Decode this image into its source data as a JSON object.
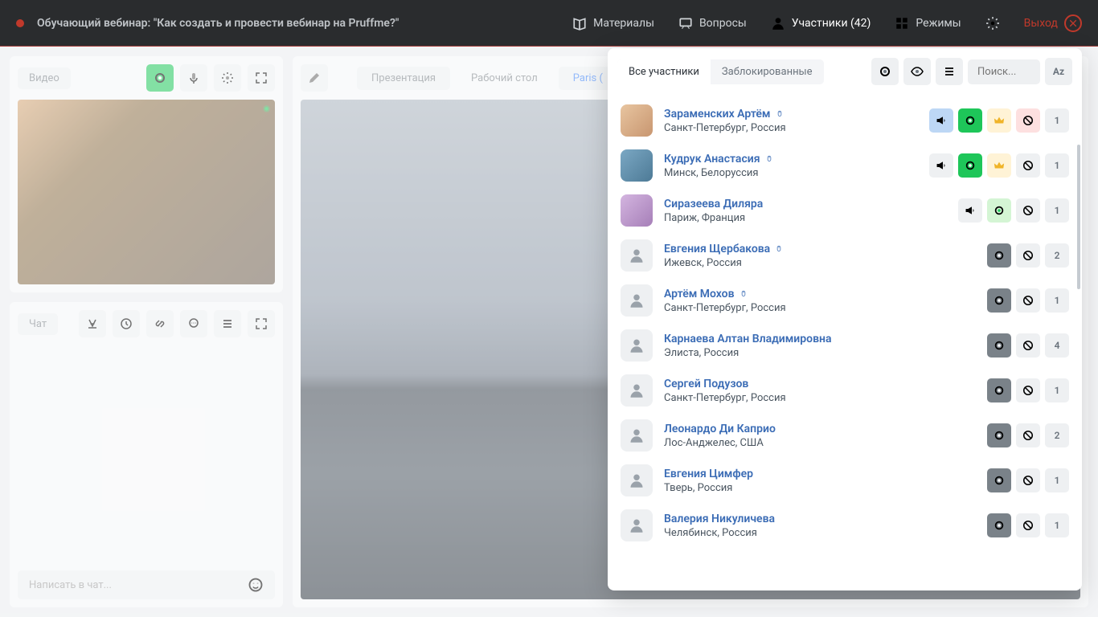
{
  "topbar": {
    "title": "Обучающий вебинар: \"Как создать и провести вебинар на Pruffme?\"",
    "menu": {
      "materials": "Материалы",
      "questions": "Вопросы",
      "participants": "Участники (42)",
      "modes": "Режимы"
    },
    "exit": "Выход"
  },
  "video": {
    "label": "Видео"
  },
  "chat": {
    "label": "Чат",
    "placeholder": "Написать в чат..."
  },
  "main": {
    "tabs": {
      "presentation": "Презентация",
      "desktop": "Рабочий стол",
      "file": "Paris ("
    }
  },
  "participants": {
    "tabs": {
      "all": "Все участники",
      "blocked": "Заблокированные"
    },
    "search_placeholder": "Поиск...",
    "sort": "Az",
    "list": [
      {
        "name": "Зараменских Артём",
        "location": "Санкт-Петербург, Россия",
        "count": "1",
        "mouse": true,
        "photo": "photo1",
        "actions": [
          "horn-blue",
          "cam-green",
          "crown-yellow",
          "ban-red"
        ]
      },
      {
        "name": "Кудрук Анастасия",
        "location": "Минск, Белоруссия",
        "count": "1",
        "mouse": true,
        "photo": "photo2",
        "actions": [
          "horn-gray",
          "cam-green",
          "crown-yellow",
          "ban-gray"
        ]
      },
      {
        "name": "Сиразеева Диляра",
        "location": "Париж, Франция",
        "count": "1",
        "mouse": false,
        "photo": "photo3",
        "actions": [
          "horn-gray-off",
          "cam-greenlt",
          "ban-gray"
        ]
      },
      {
        "name": "Евгения Щербакова",
        "location": "Ижевск, Россия",
        "count": "2",
        "mouse": true,
        "photo": "",
        "actions": [
          "cam-dark",
          "ban-gray"
        ]
      },
      {
        "name": "Артём Мохов",
        "location": "Санкт-Петербург, Россия",
        "count": "1",
        "mouse": true,
        "photo": "",
        "actions": [
          "cam-dark",
          "ban-gray"
        ]
      },
      {
        "name": "Карнаева Алтан Владимировна",
        "location": "Элиста, Россия",
        "count": "4",
        "mouse": false,
        "photo": "",
        "actions": [
          "cam-dark",
          "ban-gray"
        ]
      },
      {
        "name": "Сергей Подузов",
        "location": "Санкт-Петербург, Россия",
        "count": "1",
        "mouse": false,
        "photo": "",
        "actions": [
          "cam-dark",
          "ban-gray"
        ]
      },
      {
        "name": "Леонардо Ди Каприо",
        "location": "Лос-Анджелес, США",
        "count": "2",
        "mouse": false,
        "photo": "",
        "actions": [
          "cam-dark",
          "ban-gray"
        ]
      },
      {
        "name": "Евгения Цимфер",
        "location": "Тверь, Россия",
        "count": "1",
        "mouse": false,
        "photo": "",
        "actions": [
          "cam-dark",
          "ban-gray"
        ]
      },
      {
        "name": "Валерия Никуличева",
        "location": "Челябинск, Россия",
        "count": "1",
        "mouse": false,
        "photo": "",
        "actions": [
          "cam-dark",
          "ban-gray"
        ]
      }
    ]
  }
}
